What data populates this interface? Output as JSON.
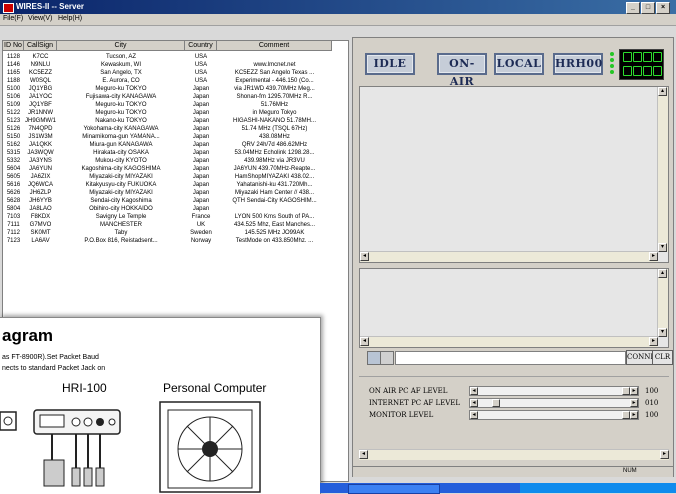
{
  "window": {
    "title": "WIRES-II -- Server",
    "btn_min": "_",
    "btn_max": "□",
    "btn_close": "×"
  },
  "menu": [
    "File(F)",
    "View(V)",
    "Help(H)"
  ],
  "table": {
    "columns": [
      "ID No",
      "CallSign",
      "City",
      "Country",
      "Comment"
    ],
    "rows": [
      [
        "1128",
        "K7CC",
        "Tucson, AZ",
        "USA",
        ""
      ],
      [
        "1146",
        "N9NLU",
        "Kewaskum, WI",
        "USA",
        "www.lmcnet.net"
      ],
      [
        "1165",
        "KC5EZZ",
        "San Angelo, TX",
        "USA",
        "KC5EZZ San Angelo Texas ..."
      ],
      [
        "1188",
        "W0SQL",
        "E. Aurora, CO",
        "USA",
        "Experimental - 446.150 (Co..."
      ],
      [
        "5100",
        "JQ1YBG",
        "Meguro-ku TOKYO",
        "Japan",
        "via JR1WD 439.70MHz Meg..."
      ],
      [
        "5106",
        "JA1YOC",
        "Fujisawa-city KANAGAWA",
        "Japan",
        "Shonan-fm 1295.70MHz R..."
      ],
      [
        "5109",
        "JQ1YBF",
        "Meguro-ku TOKYO",
        "Japan",
        "51.76MHz"
      ],
      [
        "5122",
        "JR1NNW",
        "Meguro-ku TOKYO",
        "Japan",
        "in Meguro Tokyo"
      ],
      [
        "5123",
        "JH9GMW/1",
        "Nakano-ku TOKYO",
        "Japan",
        "HIGASHI-NAKANO 51.78MH..."
      ],
      [
        "5126",
        "7N4QPD",
        "Yokohama-city KANAGAWA",
        "Japan",
        "51.74 MHz (TSQL 67Hz)"
      ],
      [
        "5150",
        "JS1W3M",
        "Minamikoma-gun YAMANA...",
        "Japan",
        "438.08MHz"
      ],
      [
        "5162",
        "JA1QKK",
        "Miura-gun KANAGAWA",
        "Japan",
        "QRV 24h/7d 486.62MHz"
      ],
      [
        "5315",
        "JA3WQW",
        "Hirakata-city OSAKA",
        "Japan",
        "53.04MHz Echolink 1298.28..."
      ],
      [
        "5332",
        "JA3YNS",
        "Mukou-city KYOTO",
        "Japan",
        "439.98MHz via JR3VU"
      ],
      [
        "5604",
        "JA6YUN",
        "Kagoshima-city KAGOSHIMA",
        "Japan",
        "JA6YUN 439.70MHz-Reapte..."
      ],
      [
        "5605",
        "JA6ZIX",
        "Miyazaki-city MIYAZAKI",
        "Japan",
        "HamShopMIYAZAKI 438.02..."
      ],
      [
        "5616",
        "JQ6WCA",
        "Kitakyusyu-city FUKUOKA",
        "Japan",
        "Yahatanishi-ku 431.720Mh..."
      ],
      [
        "5626",
        "JH6ZLP",
        "Miyazaki-city MIYAZAKI",
        "Japan",
        "Miyazaki Ham Center // 438..."
      ],
      [
        "5628",
        "JH6YYB",
        "Sendai-city Kagoshima",
        "Japan",
        "QTH Sendai-City KAGOSHIM..."
      ],
      [
        "5804",
        "JA8LAO",
        "Obihiro-city HOKKAIDO",
        "Japan",
        ""
      ],
      [
        "7103",
        "F8KDX",
        "Savigny Le Temple",
        "France",
        "LYON 500 Kms South of PA..."
      ],
      [
        "7111",
        "G7MVO",
        "MANCHESTER",
        "UK",
        "434.525 Mhz, East Manches..."
      ],
      [
        "7112",
        "SK0MT",
        "Taby",
        "Sweden",
        "145.525 MHz JO99AK"
      ],
      [
        "7123",
        "LA6AV",
        "P.O.Box 816, Reistadsent...",
        "Norway",
        "TestMode on 433.850Mhz. ..."
      ]
    ]
  },
  "buttons": {
    "idle": "IDLE",
    "onair": "ON-AIR",
    "local": "LOCAL",
    "hrh": "HRH00"
  },
  "connect": {
    "button": "CONNECT",
    "clear": "CLR"
  },
  "levels": [
    {
      "label": "ON AIR PC AF LEVEL",
      "value": "100",
      "pct": 100
    },
    {
      "label": "INTERNET PC AF LEVEL",
      "value": "010",
      "pct": 10
    },
    {
      "label": "MONITOR LEVEL",
      "value": "100",
      "pct": 100
    }
  ],
  "status": {
    "num": "NUM"
  },
  "paper": {
    "heading": "agram",
    "line1": "as FT-8900R).Set Packet Baud",
    "line2": "nects to standard Packet Jack on",
    "hri": "HRI-100",
    "pc": "Personal Computer"
  }
}
